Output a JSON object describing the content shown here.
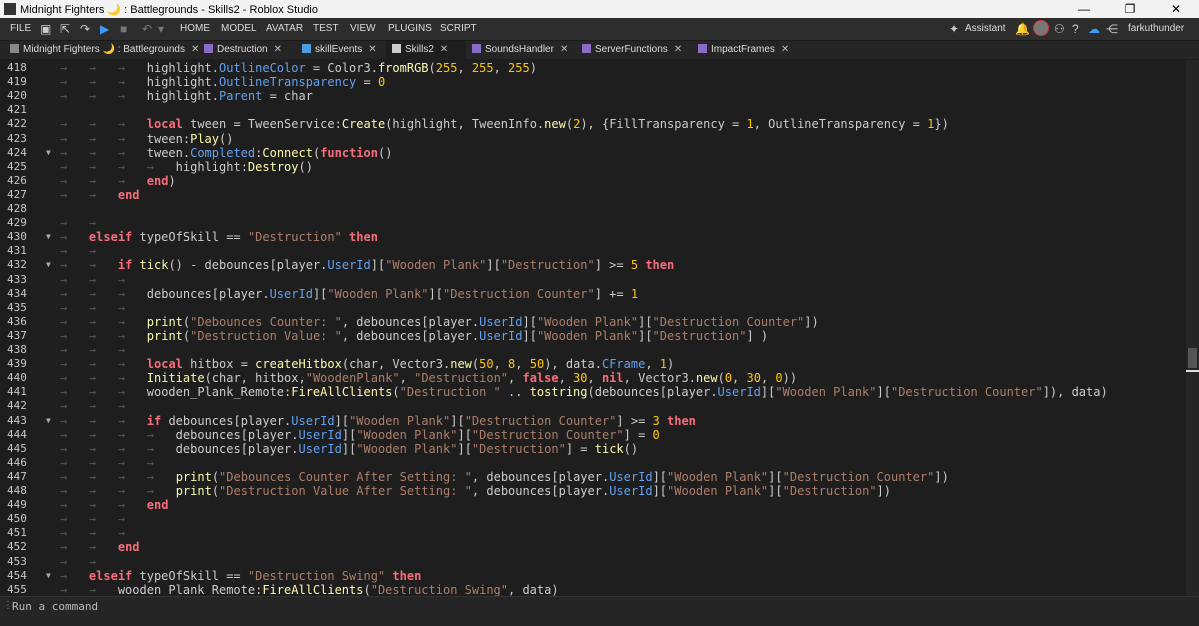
{
  "window": {
    "title": "Midnight Fighters 🌙 : Battlegrounds - Skills2 - Roblox Studio",
    "controls": [
      "—",
      "❐",
      "✕"
    ]
  },
  "menu": {
    "file": "FILE",
    "items": [
      "HOME",
      "MODEL",
      "AVATAR",
      "TEST",
      "VIEW",
      "PLUGINS",
      "SCRIPT"
    ],
    "assistant": "Assistant",
    "username": "farkuthunder"
  },
  "tabs": [
    {
      "label": "Midnight Fighters 🌙 : Battlegrounds",
      "close": "✕"
    },
    {
      "label": "Destruction",
      "close": "✕"
    },
    {
      "label": "skillEvents",
      "close": "✕"
    },
    {
      "label": "Skills2",
      "close": "✕"
    },
    {
      "label": "SoundsHandler",
      "close": "✕"
    },
    {
      "label": "ServerFunctions",
      "close": "✕"
    },
    {
      "label": "ImpactFrames",
      "close": "✕"
    }
  ],
  "code_lines": [
    {
      "n": "418",
      "fold": false,
      "indent": 3,
      "html": "highlight.<span class='prop'>OutlineColor</span> = Color3.<span class='fn'>fromRGB</span>(<span class='num'>255</span>, <span class='num'>255</span>, <span class='num'>255</span>)"
    },
    {
      "n": "419",
      "fold": false,
      "indent": 3,
      "html": "highlight.<span class='prop'>OutlineTransparency</span> = <span class='num'>0</span>"
    },
    {
      "n": "420",
      "fold": false,
      "indent": 3,
      "html": "highlight.<span class='prop'>Parent</span> = char"
    },
    {
      "n": "421",
      "fold": false,
      "indent": 0,
      "html": ""
    },
    {
      "n": "422",
      "fold": false,
      "indent": 3,
      "html": "<span class='kw'>local</span> tween = TweenService:<span class='fn'>Create</span>(highlight, TweenInfo.<span class='fn'>new</span>(<span class='num'>2</span>), {FillTransparency = <span class='num'>1</span>, OutlineTransparency = <span class='num'>1</span>})"
    },
    {
      "n": "423",
      "fold": false,
      "indent": 3,
      "html": "tween:<span class='fn'>Play</span>()"
    },
    {
      "n": "424",
      "fold": true,
      "indent": 3,
      "html": "tween.<span class='prop'>Completed</span>:<span class='fn'>Connect</span>(<span class='kw'>function</span>()"
    },
    {
      "n": "425",
      "fold": false,
      "indent": 4,
      "html": "highlight:<span class='fn'>Destroy</span>()"
    },
    {
      "n": "426",
      "fold": false,
      "indent": 3,
      "html": "<span class='kw'>end</span>)"
    },
    {
      "n": "427",
      "fold": false,
      "indent": 2,
      "html": "<span class='kw'>end</span>"
    },
    {
      "n": "428",
      "fold": false,
      "indent": 0,
      "html": ""
    },
    {
      "n": "429",
      "fold": false,
      "indent": 2,
      "html": ""
    },
    {
      "n": "430",
      "fold": true,
      "indent": 1,
      "html": "<span class='kw'>elseif</span> typeOfSkill == <span class='str'>\"Destruction\"</span> <span class='kw'>then</span>"
    },
    {
      "n": "431",
      "fold": false,
      "indent": 2,
      "html": ""
    },
    {
      "n": "432",
      "fold": true,
      "indent": 2,
      "html": "<span class='kw'>if</span> <span class='fn'>tick</span>() - debounces[player.<span class='prop'>UserId</span>][<span class='str'>\"Wooden Plank\"</span>][<span class='str'>\"Destruction\"</span>] &gt;= <span class='num'>5</span> <span class='kw'>then</span>"
    },
    {
      "n": "433",
      "fold": false,
      "indent": 3,
      "html": ""
    },
    {
      "n": "434",
      "fold": false,
      "indent": 3,
      "html": "debounces[player.<span class='prop'>UserId</span>][<span class='str'>\"Wooden Plank\"</span>][<span class='str'>\"Destruction Counter\"</span>] += <span class='num'>1</span>"
    },
    {
      "n": "435",
      "fold": false,
      "indent": 3,
      "html": ""
    },
    {
      "n": "436",
      "fold": false,
      "indent": 3,
      "html": "<span class='fn'>print</span>(<span class='str'>\"Debounces Counter: \"</span>, debounces[player.<span class='prop'>UserId</span>][<span class='str'>\"Wooden Plank\"</span>][<span class='str'>\"Destruction Counter\"</span>])"
    },
    {
      "n": "437",
      "fold": false,
      "indent": 3,
      "html": "<span class='fn'>print</span>(<span class='str'>\"Destruction Value: \"</span>, debounces[player.<span class='prop'>UserId</span>][<span class='str'>\"Wooden Plank\"</span>][<span class='str'>\"Destruction\"</span>] )"
    },
    {
      "n": "438",
      "fold": false,
      "indent": 3,
      "html": ""
    },
    {
      "n": "439",
      "fold": false,
      "indent": 3,
      "html": "<span class='kw'>local</span> hitbox = <span class='fn'>createHitbox</span>(char, Vector3.<span class='fn'>new</span>(<span class='num'>50</span>, <span class='num'>8</span>, <span class='num'>50</span>), data.<span class='prop'>CFrame</span>, <span class='num'>1</span>)"
    },
    {
      "n": "440",
      "fold": false,
      "indent": 3,
      "html": "<span class='fn'>Initiate</span>(char, hitbox,<span class='str'>\"WoodenPlank\"</span>, <span class='str'>\"Destruction\"</span>, <span class='kw'>false</span>, <span class='num'>30</span>, <span class='kw'>nil</span>, Vector3.<span class='fn'>new</span>(<span class='num'>0</span>, <span class='num'>30</span>, <span class='num'>0</span>))"
    },
    {
      "n": "441",
      "fold": false,
      "indent": 3,
      "html": "wooden_Plank_Remote:<span class='fn'>FireAllClients</span>(<span class='str'>\"Destruction \"</span> .. <span class='fn'>tostring</span>(debounces[player.<span class='prop'>UserId</span>][<span class='str'>\"Wooden Plank\"</span>][<span class='str'>\"Destruction Counter\"</span>]), data)"
    },
    {
      "n": "442",
      "fold": false,
      "indent": 3,
      "html": ""
    },
    {
      "n": "443",
      "fold": true,
      "indent": 3,
      "html": "<span class='kw'>if</span> debounces[player.<span class='prop'>UserId</span>][<span class='str'>\"Wooden Plank\"</span>][<span class='str'>\"Destruction Counter\"</span>] &gt;= <span class='num'>3</span> <span class='kw'>then</span>"
    },
    {
      "n": "444",
      "fold": false,
      "indent": 4,
      "html": "debounces[player.<span class='prop'>UserId</span>][<span class='str'>\"Wooden Plank\"</span>][<span class='str'>\"Destruction Counter\"</span>] = <span class='num'>0</span>"
    },
    {
      "n": "445",
      "fold": false,
      "indent": 4,
      "html": "debounces[player.<span class='prop'>UserId</span>][<span class='str'>\"Wooden Plank\"</span>][<span class='str'>\"Destruction\"</span>] = <span class='fn'>tick</span>()"
    },
    {
      "n": "446",
      "fold": false,
      "indent": 4,
      "html": ""
    },
    {
      "n": "447",
      "fold": false,
      "indent": 4,
      "html": "<span class='fn'>print</span>(<span class='str'>\"Debounces Counter After Setting: \"</span>, debounces[player.<span class='prop'>UserId</span>][<span class='str'>\"Wooden Plank\"</span>][<span class='str'>\"Destruction Counter\"</span>])"
    },
    {
      "n": "448",
      "fold": false,
      "indent": 4,
      "html": "<span class='fn'>print</span>(<span class='str'>\"Destruction Value After Setting: \"</span>, debounces[player.<span class='prop'>UserId</span>][<span class='str'>\"Wooden Plank\"</span>][<span class='str'>\"Destruction\"</span>])"
    },
    {
      "n": "449",
      "fold": false,
      "indent": 3,
      "html": "<span class='kw'>end</span>"
    },
    {
      "n": "450",
      "fold": false,
      "indent": 3,
      "html": ""
    },
    {
      "n": "451",
      "fold": false,
      "indent": 3,
      "html": ""
    },
    {
      "n": "452",
      "fold": false,
      "indent": 2,
      "html": "<span class='kw'>end</span>"
    },
    {
      "n": "453",
      "fold": false,
      "indent": 2,
      "html": ""
    },
    {
      "n": "454",
      "fold": true,
      "indent": 1,
      "html": "<span class='kw'>elseif</span> typeOfSkill == <span class='str'>\"Destruction Swing\"</span> <span class='kw'>then</span>"
    },
    {
      "n": "455",
      "fold": false,
      "indent": 2,
      "html": "wooden_Plank_Remote:<span class='fn'>FireAllClients</span>(<span class='str'>\"Destruction Swing\"</span>, data)"
    }
  ],
  "command_bar": {
    "placeholder": "Run a command"
  }
}
